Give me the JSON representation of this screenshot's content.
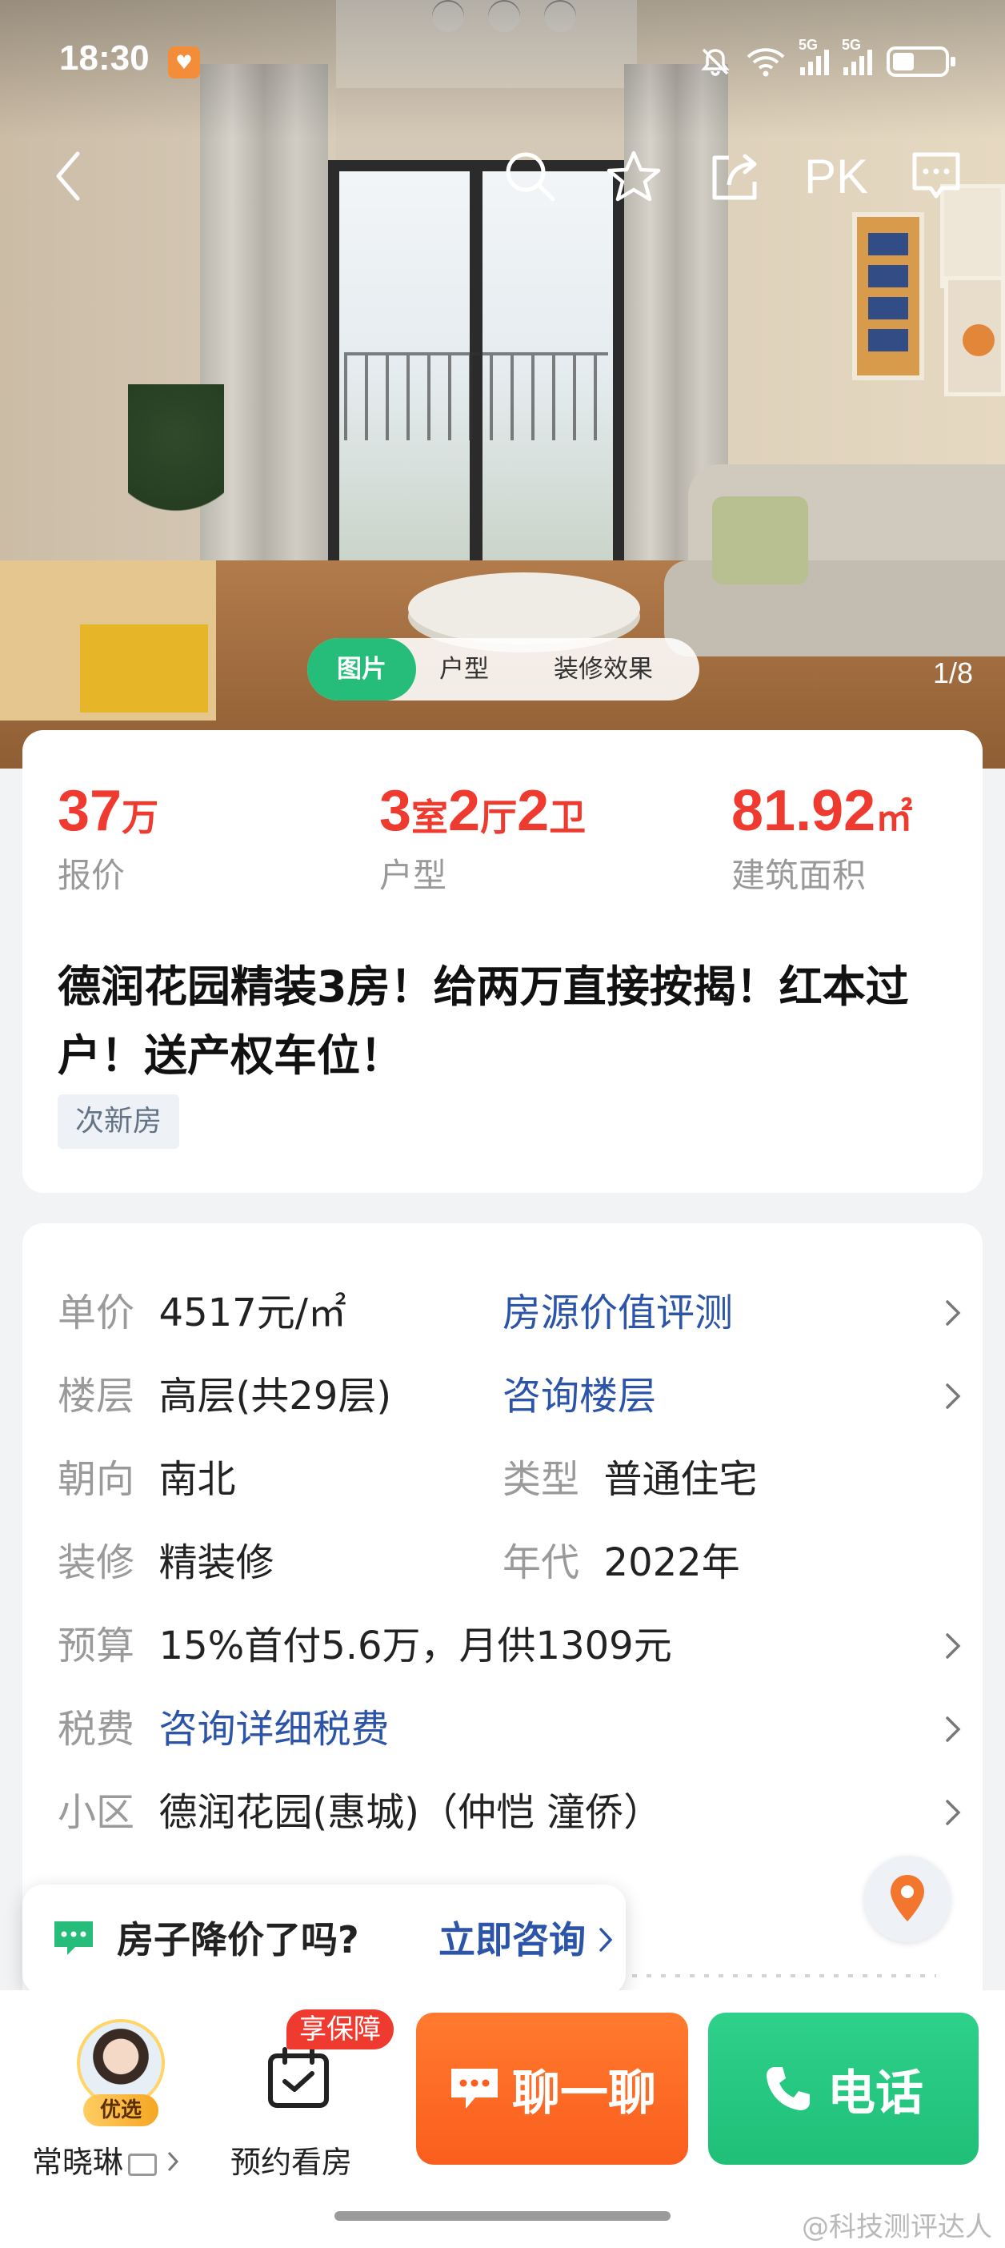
{
  "status_bar": {
    "time": "18:30",
    "network_1": "5G",
    "network_2": "5G",
    "icons": [
      "heart-icon",
      "mute-icon",
      "wifi-icon",
      "signal-icon",
      "signal-icon",
      "battery-icon"
    ]
  },
  "toolbar": {
    "back_icon": "chevron-left-icon",
    "search_icon": "search-icon",
    "favorite_icon": "star-icon",
    "share_icon": "share-icon",
    "pk_label": "PK",
    "message_icon": "chat-icon"
  },
  "gallery": {
    "tabs": [
      {
        "label": "图片",
        "active": true
      },
      {
        "label": "户型",
        "active": false
      },
      {
        "label": "装修效果",
        "active": false
      }
    ],
    "counter": "1/8"
  },
  "summary": {
    "price": {
      "value": "37",
      "unit": "万",
      "label": "报价"
    },
    "layout": {
      "part1_num": "3",
      "part1_unit": "室",
      "part2_num": "2",
      "part2_unit": "厅",
      "part3_num": "2",
      "part3_unit": "卫",
      "label": "户型"
    },
    "area": {
      "value": "81.92",
      "unit": "㎡",
      "label": "建筑面积"
    },
    "title": "德润花园精装3房！给两万直接按揭！红本过户！送产权车位！",
    "tag": "次新房",
    "accent_color": "#ef3a2f"
  },
  "details": {
    "unit_price_label": "单价",
    "unit_price_value": "4517元/㎡",
    "value_eval_link": "房源价值评测",
    "floor_label": "楼层",
    "floor_value": "高层(共29层)",
    "floor_link": "咨询楼层",
    "orientation_label": "朝向",
    "orientation_value": "南北",
    "type_label": "类型",
    "type_value": "普通住宅",
    "decor_label": "装修",
    "decor_value": "精装修",
    "year_label": "年代",
    "year_value": "2022年",
    "budget_label": "预算",
    "budget_value": "15%首付5.6万，月供1309元",
    "tax_label": "税费",
    "tax_link": "咨询详细税费",
    "community_label": "小区",
    "community_value": "德润花园(惠城)（仲恺 潼侨）",
    "link_color": "#2c54a8"
  },
  "tooltip": {
    "question": "房子降价了吗?",
    "cta": "立即咨询"
  },
  "bottom_bar": {
    "agent_badge": "优选",
    "agent_name": "常晓琳",
    "visit_badge": "享保障",
    "visit_label": "预约看房",
    "chat_label": "聊一聊",
    "call_label": "电话",
    "chat_color": "#fb5e1e",
    "call_color": "#1fbf78"
  },
  "watermark": "@科技测评达人"
}
